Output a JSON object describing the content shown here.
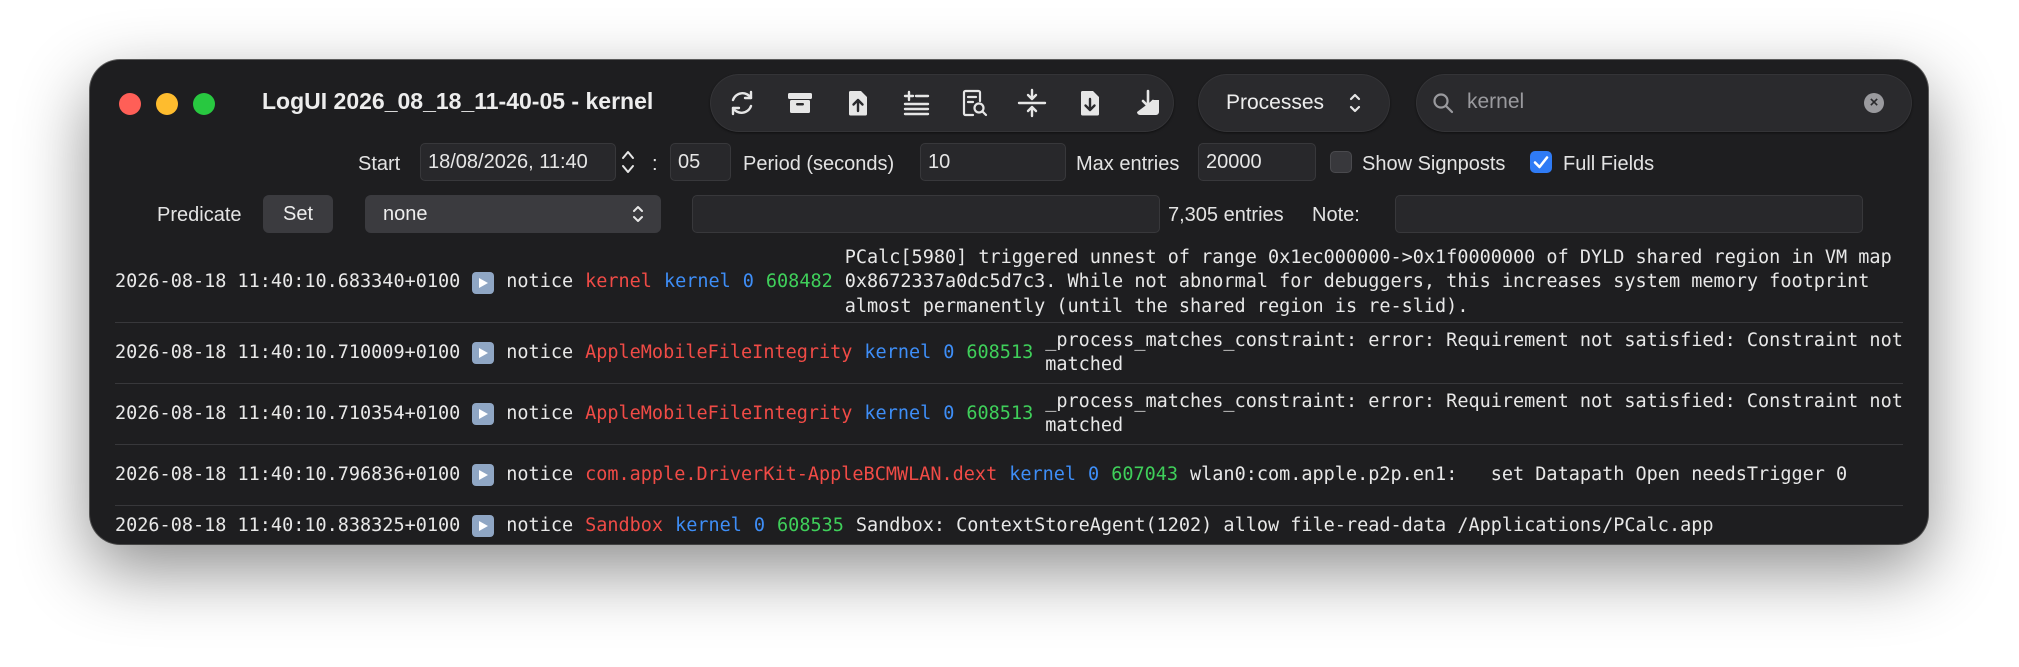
{
  "window": {
    "title": "LogUI 2026_08_18_11-40-05 - kernel"
  },
  "toolbar": {
    "buttons": [
      {
        "name": "refresh-icon"
      },
      {
        "name": "archive-icon"
      },
      {
        "name": "share-icon"
      },
      {
        "name": "add-list-icon"
      },
      {
        "name": "find-in-document-icon"
      },
      {
        "name": "collapse-icon"
      },
      {
        "name": "download-document-icon"
      },
      {
        "name": "save-tray-icon"
      }
    ],
    "process_selector": "Processes",
    "search": {
      "value": "kernel"
    }
  },
  "controls": {
    "start_label": "Start",
    "start_value": "18/08/2026, 11:40",
    "colon": ":",
    "seconds_value": "05",
    "period_label": "Period (seconds)",
    "period_value": "10",
    "max_entries_label": "Max entries",
    "max_entries_value": "20000",
    "show_signposts_label": "Show Signposts",
    "show_signposts_checked": false,
    "full_fields_label": "Full Fields",
    "full_fields_checked": true,
    "predicate_label": "Predicate",
    "set_label": "Set",
    "predicate_select": "none",
    "entries_count": "7,305 entries",
    "note_label": "Note:"
  },
  "log_rows": [
    {
      "timestamp": "2026-08-18 11:40:10.683340+0100",
      "level": "notice",
      "process": "kernel",
      "subsystem": "kernel",
      "pid": "0",
      "thread": "608482",
      "message": "PCalc[5980] triggered unnest of range 0x1ec000000->0x1f0000000 of DYLD shared region in VM map 0x8672337a0dc5d7c3. While not abnormal for debuggers, this increases system memory footprint almost permanently (until the shared region is re-slid)."
    },
    {
      "timestamp": "2026-08-18 11:40:10.710009+0100",
      "level": "notice",
      "process": "AppleMobileFileIntegrity",
      "subsystem": "kernel",
      "pid": "0",
      "thread": "608513",
      "message": "_process_matches_constraint: error: Requirement not satisfied: Constraint not matched"
    },
    {
      "timestamp": "2026-08-18 11:40:10.710354+0100",
      "level": "notice",
      "process": "AppleMobileFileIntegrity",
      "subsystem": "kernel",
      "pid": "0",
      "thread": "608513",
      "message": "_process_matches_constraint: error: Requirement not satisfied: Constraint not matched"
    },
    {
      "timestamp": "2026-08-18 11:40:10.796836+0100",
      "level": "notice",
      "process": "com.apple.DriverKit-AppleBCMWLAN.dext",
      "subsystem": "kernel",
      "pid": "0",
      "thread": "607043",
      "message": "wlan0:com.apple.p2p.en1:   set Datapath Open needsTrigger 0"
    },
    {
      "timestamp": "2026-08-18 11:40:10.838325+0100",
      "level": "notice",
      "process": "Sandbox",
      "subsystem": "kernel",
      "pid": "0",
      "thread": "608535",
      "message": "Sandbox: ContextStoreAgent(1202) allow file-read-data /Applications/PCalc.app"
    }
  ]
}
